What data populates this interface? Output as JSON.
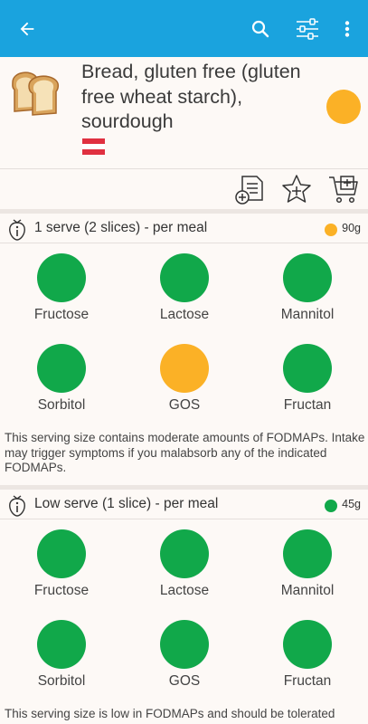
{
  "colors": {
    "appbar": "#1aa3de",
    "green": "#11a84a",
    "amber": "#fbb126",
    "flag_red": "#e03040"
  },
  "appbar": {
    "back_icon": "arrow-left-icon",
    "search_icon": "search-icon",
    "filter_icon": "sliders-icon",
    "more_icon": "more-vert-icon"
  },
  "food": {
    "title": "Bread, gluten free (gluten free wheat starch), sourdough",
    "overall_rating": "amber",
    "flag_icon": "flag-icon"
  },
  "actions": [
    {
      "icon": "add-to-list-icon"
    },
    {
      "icon": "add-favourite-star-icon"
    },
    {
      "icon": "add-to-cart-icon"
    }
  ],
  "servings": [
    {
      "label": "1 serve (2 slices) - per meal",
      "weight": "90g",
      "rating": "amber",
      "fodmaps": [
        {
          "name": "Fructose",
          "rating": "green"
        },
        {
          "name": "Lactose",
          "rating": "green"
        },
        {
          "name": "Mannitol",
          "rating": "green"
        },
        {
          "name": "Sorbitol",
          "rating": "green"
        },
        {
          "name": "GOS",
          "rating": "amber"
        },
        {
          "name": "Fructan",
          "rating": "green"
        }
      ],
      "note": "This serving size contains moderate amounts of FODMAPs. Intake may trigger symptoms if you malabsorb any of the indicated FODMAPs."
    },
    {
      "label": "Low serve (1 slice) - per meal",
      "weight": "45g",
      "rating": "green",
      "fodmaps": [
        {
          "name": "Fructose",
          "rating": "green"
        },
        {
          "name": "Lactose",
          "rating": "green"
        },
        {
          "name": "Mannitol",
          "rating": "green"
        },
        {
          "name": "Sorbitol",
          "rating": "green"
        },
        {
          "name": "GOS",
          "rating": "green"
        },
        {
          "name": "Fructan",
          "rating": "green"
        }
      ],
      "note": "This serving size is low in FODMAPs and should be tolerated"
    }
  ]
}
